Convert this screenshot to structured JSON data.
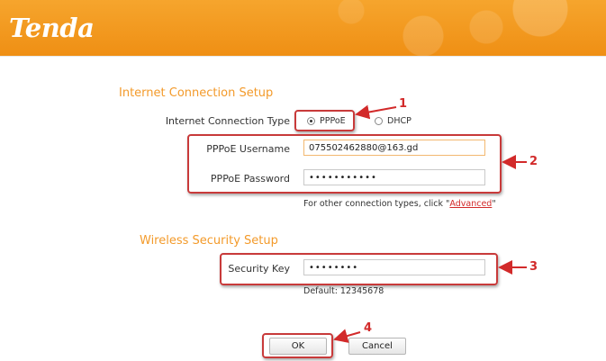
{
  "brand": {
    "logo_text": "Tenda"
  },
  "internet": {
    "section_title": "Internet Connection Setup",
    "connection_type_label": "Internet Connection Type",
    "options": [
      {
        "label": "PPPoE",
        "selected": true
      },
      {
        "label": "DHCP",
        "selected": false
      }
    ],
    "username_label": "PPPoE Username",
    "username_value": "075502462880@163.gd",
    "password_label": "PPPoE Password",
    "password_value": "•••••••••••",
    "note_prefix": "For other connection types, click \"",
    "note_link": "Advanced",
    "note_suffix": "\""
  },
  "wireless": {
    "section_title": "Wireless Security Setup",
    "key_label": "Security Key",
    "key_value": "••••••••",
    "default_note": "Default: 12345678"
  },
  "buttons": {
    "ok_label": "OK",
    "cancel_label": "Cancel"
  },
  "callouts": [
    "1",
    "2",
    "3",
    "4"
  ],
  "colors": {
    "header": "#f39a1e",
    "section_title": "#f39a2a",
    "highlight": "#c83a3a",
    "link": "#d22a2a"
  }
}
